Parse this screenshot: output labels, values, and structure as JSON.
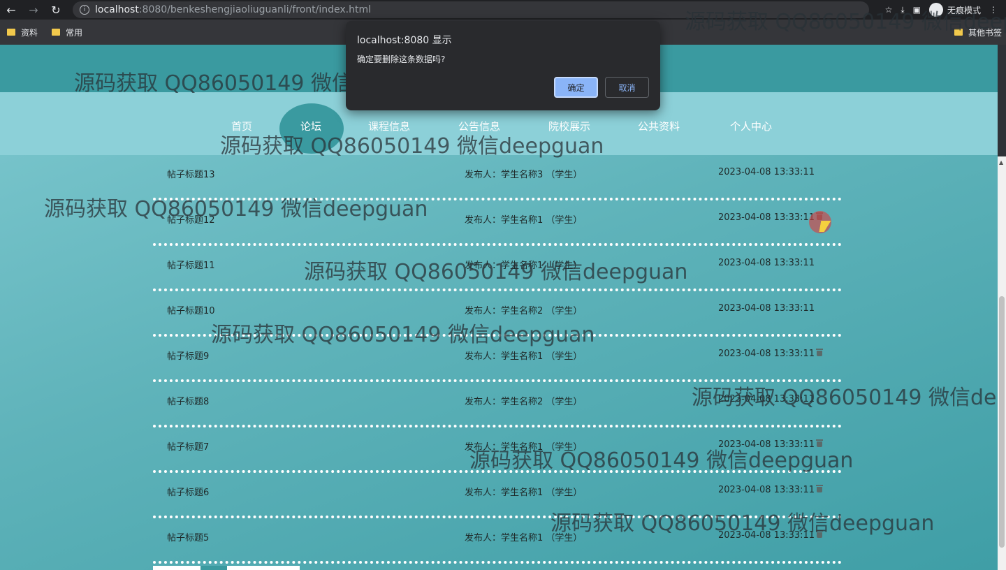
{
  "browser": {
    "url_host": "localhost",
    "url_path": ":8080/benkeshengjiaoliuguanli/front/index.html",
    "incognito_label": "无痕模式",
    "bookmarks": [
      "资料",
      "常用"
    ],
    "other_bookmarks": "其他书签"
  },
  "nav": {
    "items": [
      "首页",
      "论坛",
      "课程信息",
      "公告信息",
      "院校展示",
      "公共资料",
      "个人中心"
    ],
    "active": "论坛"
  },
  "posts": [
    {
      "title": "帖子标题13",
      "author": "发布人：学生名称3 （学生）",
      "time": "2023-04-08 13:33:11"
    },
    {
      "title": "帖子标题12",
      "author": "发布人：学生名称1 （学生）",
      "time": "2023-04-08 13:33:11"
    },
    {
      "title": "帖子标题11",
      "author": "发布人：学生名称1 （学生）",
      "time": "2023-04-08 13:33:11"
    },
    {
      "title": "帖子标题10",
      "author": "发布人：学生名称2 （学生）",
      "time": "2023-04-08 13:33:11"
    },
    {
      "title": "帖子标题9",
      "author": "发布人：学生名称1 （学生）",
      "time": "2023-04-08 13:33:11"
    },
    {
      "title": "帖子标题8",
      "author": "发布人：学生名称2 （学生）",
      "time": "2023-04-08 13:33:11"
    },
    {
      "title": "帖子标题7",
      "author": "发布人：学生名称1 （学生）",
      "time": "2023-04-08 13:33:11"
    },
    {
      "title": "帖子标题6",
      "author": "发布人：学生名称1 （学生）",
      "time": "2023-04-08 13:33:11"
    },
    {
      "title": "帖子标题5",
      "author": "发布人：学生名称1 （学生）",
      "time": "2023-04-08 13:33:11"
    }
  ],
  "dialog": {
    "title": "localhost:8080 显示",
    "message": "确定要删除这条数据吗?",
    "ok_label": "确定",
    "cancel_label": "取消"
  },
  "watermark": "源码获取 QQ86050149 微信deepguan",
  "colors": {
    "header": "#3a9aa0",
    "nav_band": "#8cd0d8",
    "dialog_bg": "#292a2d",
    "ok_button": "#8ab4f8"
  }
}
